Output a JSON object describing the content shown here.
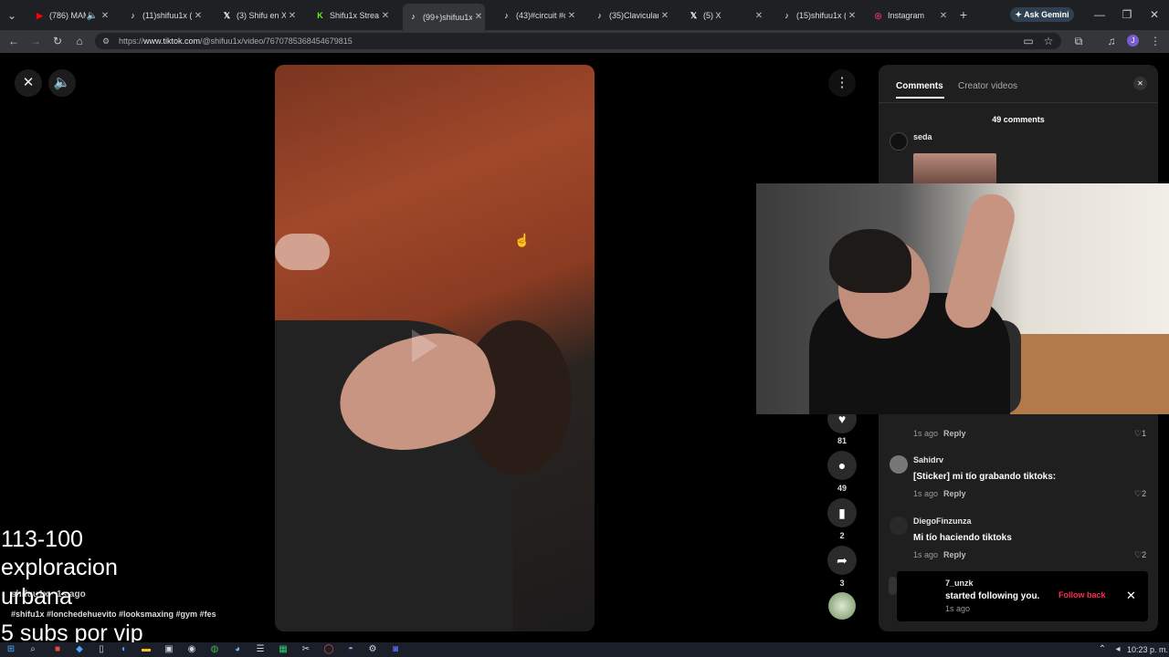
{
  "tabs": [
    {
      "title": "(786) MAM",
      "favicon": "youtube-icon",
      "color": "#ff0000",
      "glyph": "▶",
      "audio": true
    },
    {
      "title": "(11)shifuu1x (@",
      "favicon": "tiktok-icon",
      "color": "#ffffff",
      "glyph": "♪"
    },
    {
      "title": "(3) Shifu en X:",
      "favicon": "x-icon",
      "color": "#ffffff",
      "glyph": "𝕏"
    },
    {
      "title": "Shifu1x Stream",
      "favicon": "kick-icon",
      "color": "#53fc18",
      "glyph": "K"
    },
    {
      "title": "(99+)shifuu1x (",
      "favicon": "tiktok-icon",
      "color": "#ffffff",
      "glyph": "♪",
      "active": true
    },
    {
      "title": "(43)#circuit #ci",
      "favicon": "tiktok-icon",
      "color": "#ffffff",
      "glyph": "♪"
    },
    {
      "title": "(35)Clavicular (",
      "favicon": "tiktok-icon",
      "color": "#ffffff",
      "glyph": "♪"
    },
    {
      "title": "(5) X",
      "favicon": "x-icon",
      "color": "#ffffff",
      "glyph": "𝕏"
    },
    {
      "title": "(15)shifuu1x (@",
      "favicon": "tiktok-icon",
      "color": "#ffffff",
      "glyph": "♪"
    },
    {
      "title": "Instagram",
      "favicon": "instagram-icon",
      "color": "#e1306c",
      "glyph": "◎"
    }
  ],
  "gemini_label": "Ask Gemini",
  "url_domain": "www.tiktok.com",
  "url_prefix": "https://",
  "url_path": "/@shifuu1x/video/7670785368454679815",
  "video": {
    "author": "shifuu1x",
    "time_ago": "1s ago",
    "hashtags": "#shifu1x #lonchedehuevito #looksmaxing #gym #fes"
  },
  "actions": {
    "likes": "81",
    "comments": "49",
    "saves": "2",
    "shares": "3"
  },
  "panel": {
    "tab_comments": "Comments",
    "tab_creator": "Creator videos",
    "comment_count": "49 comments",
    "first_commenter": "seda",
    "hidden_comment_meta": "1s ago",
    "hidden_comment_likes": "1",
    "reply_label": "Reply",
    "comments": [
      {
        "user": "Sahidrv",
        "text": "[Sticker] mi tío grabando tiktoks:",
        "time": "1s ago",
        "likes": "2"
      },
      {
        "user": "DiegoFinzunza",
        "text": "Mi tío haciendo tiktoks",
        "time": "1s ago",
        "likes": "2"
      }
    ]
  },
  "notification": {
    "user": "7_unzk",
    "message": "started following you.",
    "time": "1s ago",
    "action": "Follow back"
  },
  "overlay": {
    "line1": "113-100",
    "line2": "exploracion",
    "line3": "urbana",
    "line4": "5 subs por vip"
  },
  "clock": "10:23 p. m."
}
